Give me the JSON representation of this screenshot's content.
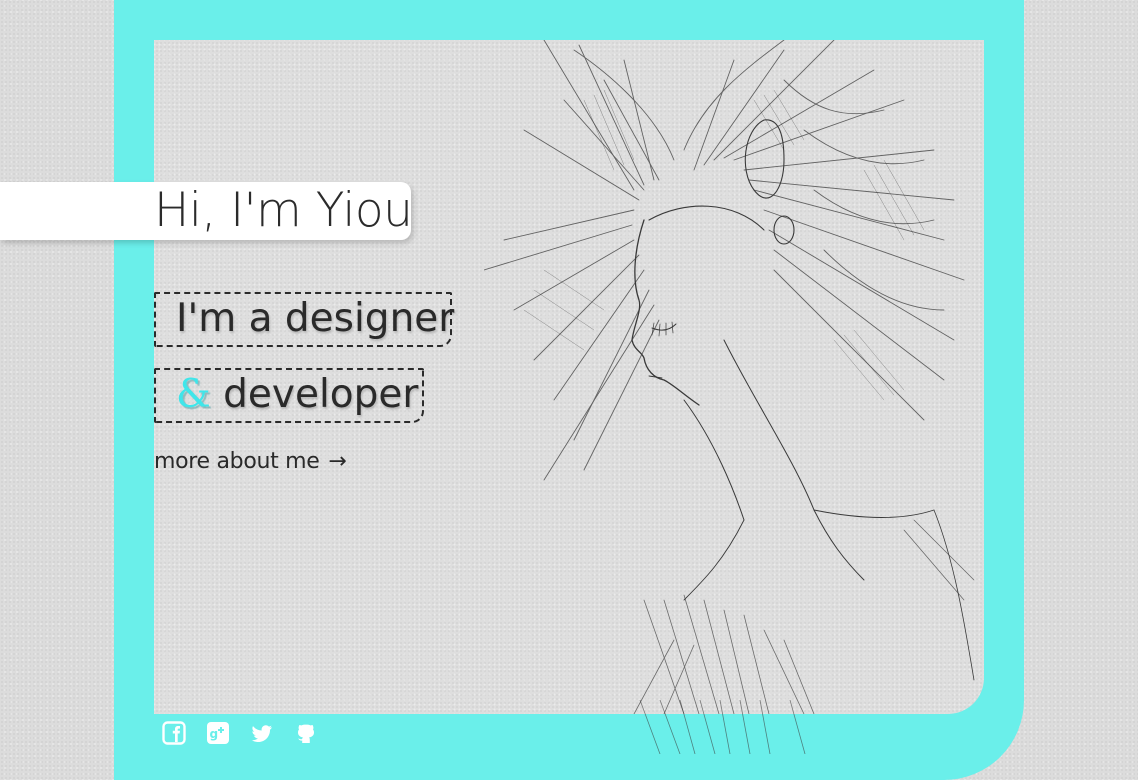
{
  "hero": {
    "greeting": "Hi, I'm Yiou",
    "role_line_1": "I'm a designer",
    "role_line_2_amp": "&",
    "role_line_2": " developer",
    "more_link": "more about me",
    "more_arrow": "→"
  },
  "social": [
    "facebook-icon",
    "google-plus-icon",
    "twitter-icon",
    "github-icon"
  ],
  "colors": {
    "accent": "#6aefea",
    "amp_accent": "#3fe6ea",
    "text": "#2a2a2a",
    "background": "#dcdcdc"
  }
}
